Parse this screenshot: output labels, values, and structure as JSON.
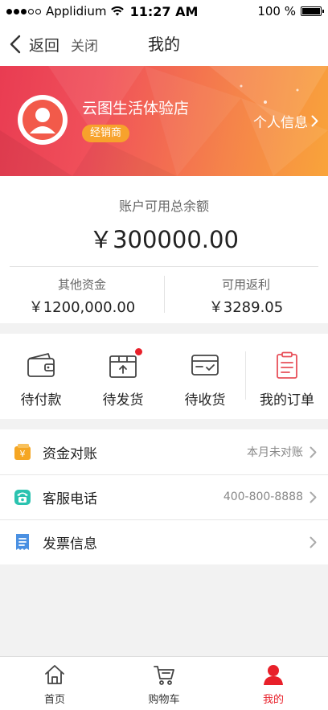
{
  "status_bar": {
    "carrier": "Applidium",
    "time": "11:27 AM",
    "battery_text": "100 %"
  },
  "nav": {
    "back_label": "返回",
    "close_label": "关闭",
    "title": "我的"
  },
  "profile": {
    "shop_name": "云图生活体验店",
    "role_badge": "经销商",
    "profile_link": "个人信息",
    "banner_gradient": [
      "#e93c52",
      "#f9a43a"
    ]
  },
  "balance": {
    "label": "账户可用总余额",
    "amount": "￥300000.00",
    "other_funds_label": "其他资金",
    "other_funds_value": "￥1200,000.00",
    "rebate_label": "可用返利",
    "rebate_value": "￥3289.05"
  },
  "orders": [
    {
      "label": "待付款",
      "icon": "wallet-icon"
    },
    {
      "label": "待发货",
      "icon": "package-icon",
      "has_badge": true
    },
    {
      "label": "待收货",
      "icon": "card-check-icon"
    },
    {
      "label": "我的订单",
      "icon": "clipboard-icon"
    }
  ],
  "list": [
    {
      "label": "资金对账",
      "value": "本月未对账",
      "icon": "yuan-wallet-icon"
    },
    {
      "label": "客服电话",
      "value": "400-800-8888",
      "icon": "phone-icon"
    },
    {
      "label": "发票信息",
      "value": "",
      "icon": "invoice-icon"
    }
  ],
  "tabs": [
    {
      "label": "首页",
      "icon": "home-icon"
    },
    {
      "label": "购物车",
      "icon": "cart-icon"
    },
    {
      "label": "我的",
      "icon": "user-icon",
      "active": true
    }
  ],
  "colors": {
    "accent": "#e8202a",
    "badge": "#f7a22c",
    "yuan_icon": "#f5a623",
    "phone_icon": "#2bc3b0",
    "invoice_icon": "#4a90e2"
  }
}
